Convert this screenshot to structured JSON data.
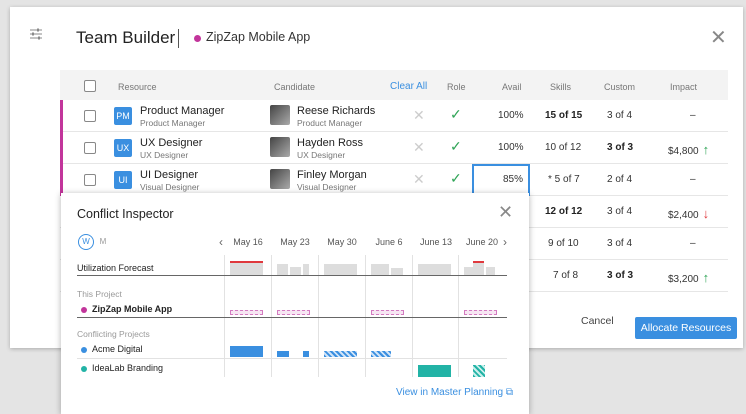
{
  "header": {
    "title": "Team Builder",
    "project": "ZipZap Mobile App"
  },
  "table": {
    "columns": {
      "resource": "Resource",
      "candidate": "Candidate",
      "clear_all": "Clear All",
      "role": "Role",
      "avail": "Avail",
      "skills": "Skills",
      "custom": "Custom",
      "impact": "Impact"
    },
    "rows": [
      {
        "badge": "PM",
        "resource": "Product Manager",
        "resource_sub": "Product Manager",
        "candidate": "Reese Richards",
        "candidate_sub": "Product Manager",
        "avail": "100%",
        "skills": "15 of 15",
        "custom": "3 of 4",
        "impact": "–"
      },
      {
        "badge": "UX",
        "resource": "UX Designer",
        "resource_sub": "UX Designer",
        "candidate": "Hayden Ross",
        "candidate_sub": "UX Designer",
        "avail": "100%",
        "skills": "10 of 12",
        "custom": "3 of 3",
        "impact": "$4,800"
      },
      {
        "badge": "UI",
        "resource": "UI Designer",
        "resource_sub": "Visual Designer",
        "candidate": "Finley Morgan",
        "candidate_sub": "Visual Designer",
        "avail": "85%",
        "skills": "* 5 of 7",
        "custom": "2 of 4",
        "impact": "–"
      },
      {
        "skills": "12 of 12",
        "custom": "3 of 4",
        "impact": "$2,400"
      },
      {
        "skills": "9 of 10",
        "custom": "3 of 4",
        "impact": "–"
      },
      {
        "skills": "7 of 8",
        "custom": "3 of 3",
        "impact": "$3,200"
      }
    ]
  },
  "footer": {
    "cancel": "Cancel",
    "allocate": "Allocate Resources"
  },
  "inspector": {
    "title": "Conflict Inspector",
    "toggle_w": "W",
    "toggle_m": "M",
    "dates": [
      "May 16",
      "May 23",
      "May 30",
      "June 6",
      "June 13",
      "June 20"
    ],
    "utilization": "Utilization Forecast",
    "this_project_label": "This Project",
    "this_project": "ZipZap Mobile App",
    "conflicting_label": "Conflicting Projects",
    "conflict_1": "Acme Digital",
    "conflict_2": "IdeaLab Branding",
    "link": "View in Master Planning"
  },
  "colors": {
    "accent": "#3a8fe0",
    "magenta": "#c2359b",
    "green": "#2fa456",
    "red": "#e0393e",
    "teal": "#22b3a6"
  },
  "icons": [
    "sliders-icon",
    "close-icon",
    "check-icon",
    "cross-icon",
    "arrow-up-icon",
    "arrow-down-icon",
    "external-link-icon"
  ]
}
